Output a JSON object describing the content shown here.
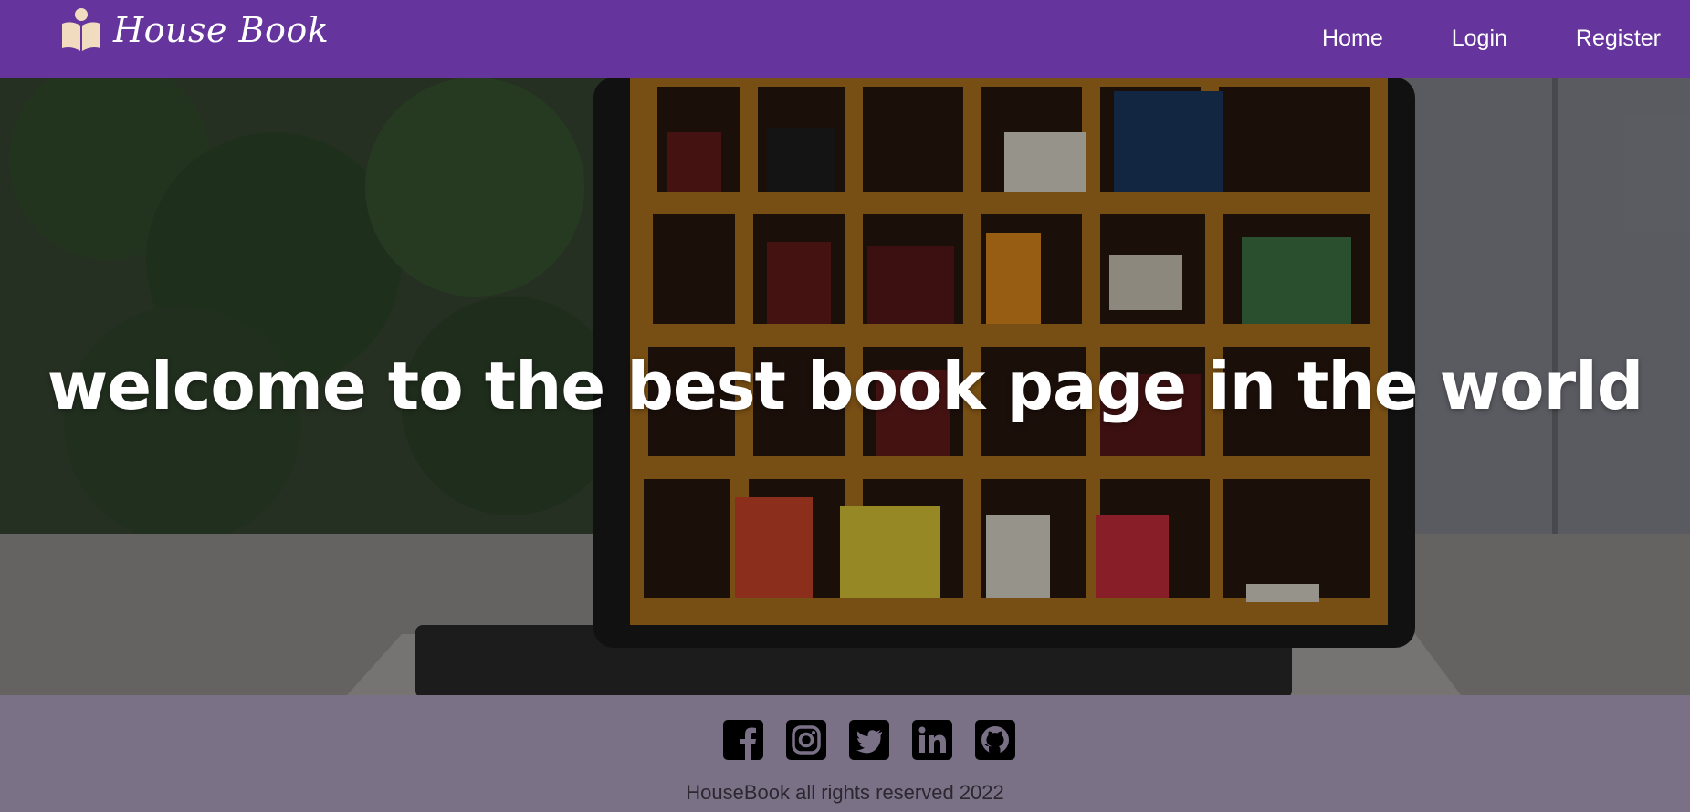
{
  "brand": {
    "name": "House Book",
    "color": "#65349c"
  },
  "nav": {
    "items": [
      {
        "label": "Home"
      },
      {
        "label": "Login"
      },
      {
        "label": "Register"
      }
    ]
  },
  "hero": {
    "title": "welcome to the best book page in the world",
    "image": "laptop-screen-showing-bookshelf"
  },
  "footer": {
    "social_icons": [
      "facebook-icon",
      "instagram-icon",
      "twitter-icon",
      "linkedin-icon",
      "github-icon"
    ],
    "copyright": "HouseBook all rights reserved 2022",
    "background": "#7b7187"
  }
}
